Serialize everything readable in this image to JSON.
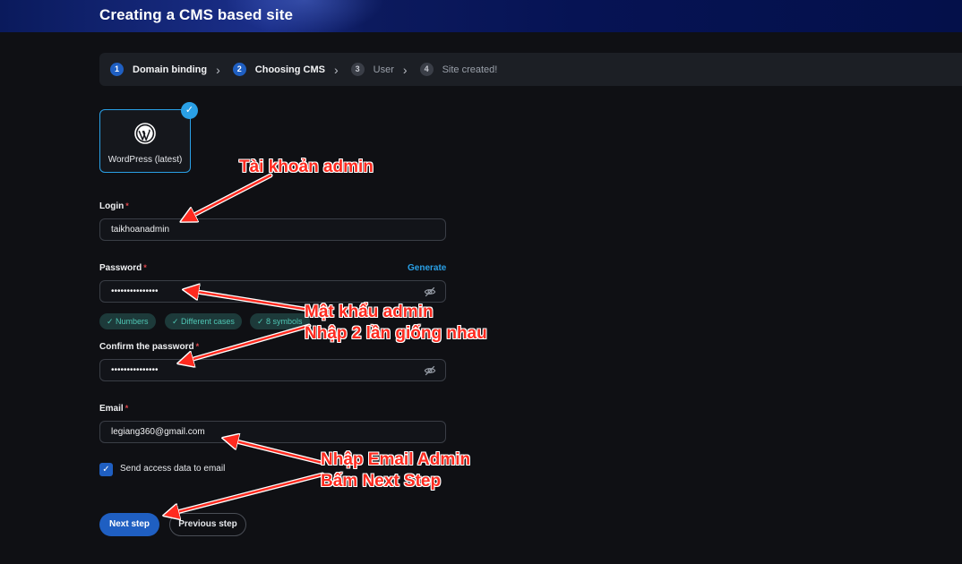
{
  "header": {
    "title": "Creating a CMS based site"
  },
  "stepper": {
    "steps": [
      {
        "number": "1",
        "label": "Domain binding"
      },
      {
        "number": "2",
        "label": "Choosing CMS"
      },
      {
        "number": "3",
        "label": "User"
      },
      {
        "number": "4",
        "label": "Site created!"
      }
    ]
  },
  "cms": {
    "selected_label": "WordPress (latest)"
  },
  "form": {
    "login": {
      "label": "Login",
      "value": "taikhoanadmin"
    },
    "password": {
      "label": "Password",
      "value": "•••••••••••••••",
      "generate_label": "Generate",
      "chips": [
        "Numbers",
        "Different cases",
        "8 symbols"
      ]
    },
    "confirm": {
      "label": "Confirm the password",
      "value": "•••••••••••••••"
    },
    "email": {
      "label": "Email",
      "value": "legiang360@gmail.com"
    },
    "send_access": {
      "label": "Send access data to email",
      "checked": true
    },
    "required_mark": "*"
  },
  "buttons": {
    "next": "Next step",
    "previous": "Previous step"
  },
  "annotations": {
    "admin_account": "Tài khoản admin",
    "admin_password_1": "Mật khẩu admin",
    "admin_password_2": "Nhập 2 lần giống nhau",
    "email_1": "Nhập Email Admin",
    "email_2": "Bấm Next Step"
  },
  "colors": {
    "accent": "#1f5fc2",
    "link": "#2aa0e6",
    "annotation": "#ff2a1f"
  }
}
